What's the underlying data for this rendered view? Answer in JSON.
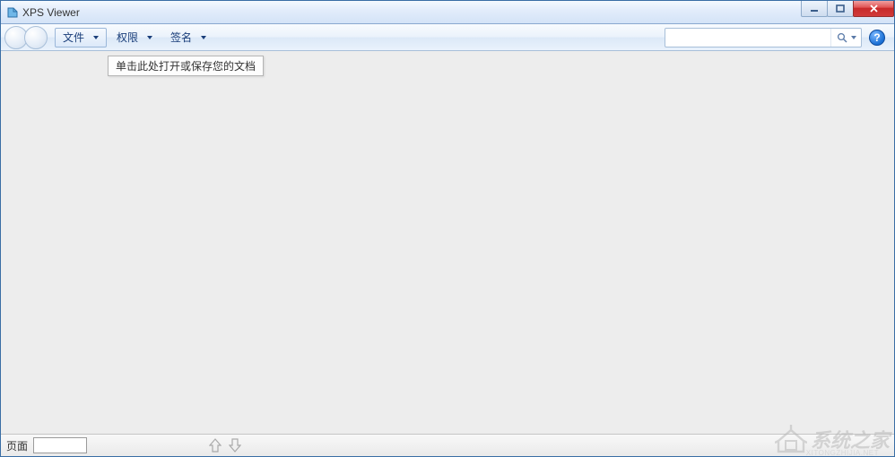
{
  "window": {
    "title": "XPS Viewer"
  },
  "toolbar": {
    "menus": {
      "file": "文件",
      "permissions": "权限",
      "signature": "签名"
    },
    "search_placeholder": ""
  },
  "tooltip": {
    "text": "单击此处打开或保存您的文档"
  },
  "statusbar": {
    "page_label": "页面",
    "page_value": ""
  },
  "help": {
    "symbol": "?"
  },
  "watermark": {
    "text": "系统之家",
    "sub": "XITONGZHIJIA.NET"
  }
}
